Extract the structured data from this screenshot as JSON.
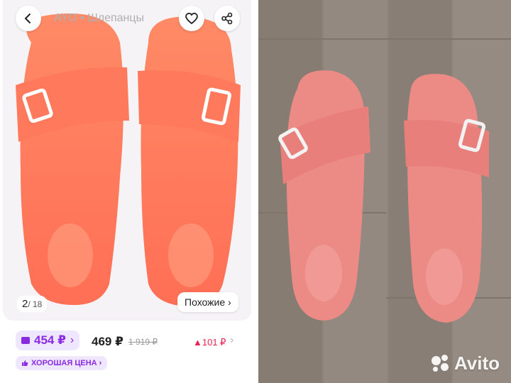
{
  "left": {
    "title": "AYO • Шлепанцы",
    "photo_counter": {
      "current": "2",
      "total": "/ 18"
    },
    "similar_button": "Похожие ›",
    "wallet_price": "454 ₽",
    "wallet_chevron": "›",
    "price": "469 ₽",
    "old_price": "1 919 ₽",
    "price_diff": "▲101 ₽",
    "row_chevron": "›",
    "good_price_badge": "ХОРОШАЯ ЦЕНА ›",
    "icons": [
      "back-arrow-icon",
      "heart-icon",
      "share-icon",
      "wallet-icon",
      "thumbs-up-icon"
    ],
    "colors": {
      "accent": "#8a2be2",
      "price_up": "#e4254d",
      "sandal": "#ff7a5c"
    }
  },
  "right": {
    "watermark": "Avito",
    "colors": {
      "floor": "#8a8077",
      "sandal": "#ec8a86"
    }
  }
}
